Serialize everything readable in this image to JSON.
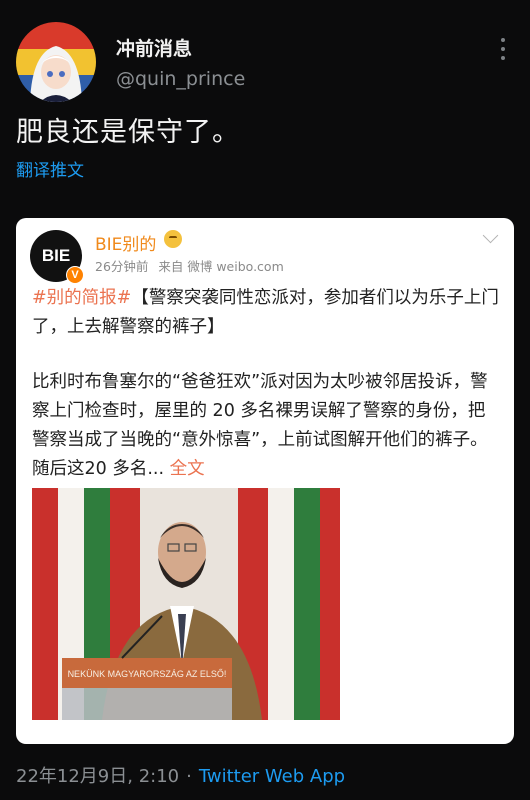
{
  "tweet": {
    "author_name": "冲前消息",
    "author_handle": "@quin_prince",
    "text": "肥良还是保守了。",
    "translate_label": "翻译推文",
    "date_time": "22年12月9日, 2:10",
    "separator": "·",
    "app": "Twitter Web App"
  },
  "quoted_card": {
    "logo_text": "BIE",
    "verified_badge": "V",
    "account_name": "BIE别的",
    "time_ago": "26分钟前",
    "source": "来自 微博 weibo.com",
    "hashtag": "#别的简报#",
    "headline": "【警察突袭同性恋派对，参加者们以为乐子上门了，上去解警察的裤子】",
    "body": "比利时布鲁塞尔的“爸爸狂欢”派对因为太吵被邻居投诉，警察上门检查时，屋里的 20 多名裸男误解了警察的身份，把警察当成了当晚的“意外惊喜”，上前试图解开他们的裤子。随后这20 多名...",
    "more_label": "全文",
    "image_banner_text": "NEKÜNK MAGYARORSZÁG AZ ELSŐ!"
  },
  "colors": {
    "background": "#0b0b0c",
    "link_blue": "#1d9bf0",
    "weibo_orange": "#eb7350",
    "card_bg": "#ffffff"
  },
  "icons": [
    "more-options-icon",
    "verified-icon",
    "emoji-icon",
    "chevron-down-icon"
  ]
}
